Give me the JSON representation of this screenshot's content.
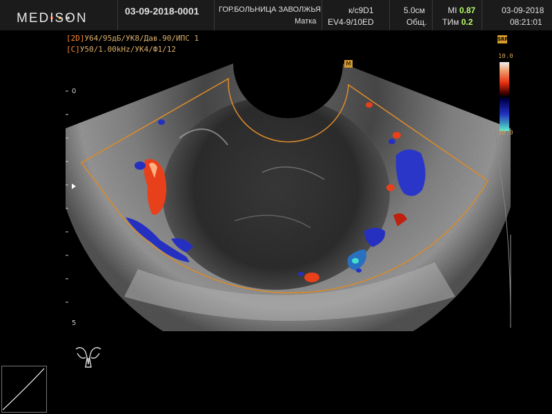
{
  "header": {
    "logo": "MEDISON",
    "patient_id": "03-09-2018-0001",
    "hospital": "ГОР.БОЛЬНИЦА ЗАВОЛЖЬЯ",
    "preset": "Матка",
    "probe": "к/с9D1",
    "probe_mode": "EV4-9/10ED",
    "depth": "5.0см",
    "mode": "Общ.",
    "mi_label": "MI",
    "mi_value": "0.87",
    "tim_label": "ТИм",
    "tim_value": "0.2",
    "date": "03-09-2018",
    "time": "08:21:01"
  },
  "params": {
    "line1_tag": "[2D]",
    "line1_text": "У64/95дБ/УК8/Дав.90/ИПС 1",
    "line2_tag": "[C]",
    "line2_text": "У50/1.00kHz/УК4/Ф1/12"
  },
  "scale": {
    "top": "0",
    "bottom": "5"
  },
  "color_bar": {
    "max": "10.0",
    "min": "10.0",
    "badge": "SRF"
  },
  "controls": {
    "marker": "M"
  },
  "colors": {
    "accent": "#d98a2b",
    "doppler_red": "#e8401a",
    "doppler_blue": "#2630c0",
    "value_green": "#b9ff6a"
  }
}
